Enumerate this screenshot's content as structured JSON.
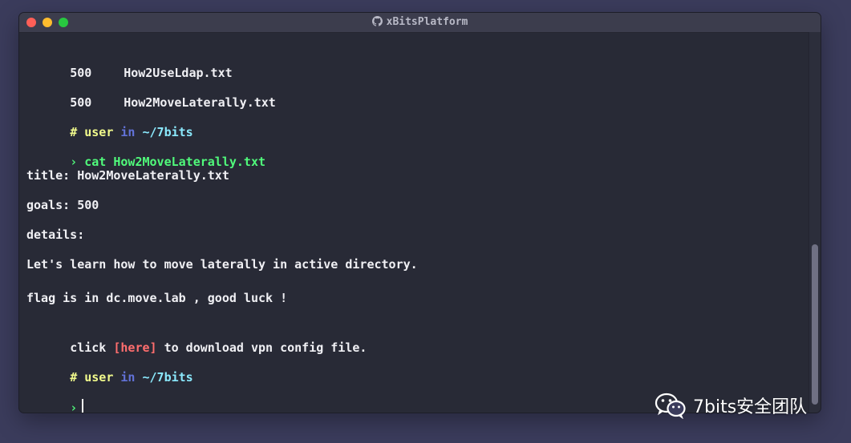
{
  "window": {
    "title": "xBitsPlatform",
    "title_icon": "github-icon",
    "controls": [
      "close",
      "minimize",
      "maximize"
    ]
  },
  "terminal": {
    "partial_top_line": "                        ",
    "rows": [
      {
        "num": "500",
        "name": "How2UseLdap.txt"
      },
      {
        "num": "500",
        "name": "How2MoveLaterally.txt"
      }
    ],
    "prompt1": {
      "hash": "#",
      "user": "user",
      "in": "in",
      "path": "~/7bits"
    },
    "command": {
      "arrow": "›",
      "text": "cat How2MoveLaterally.txt"
    },
    "output": {
      "title": "title: How2MoveLaterally.txt",
      "goals": "goals: 500",
      "details": "details:",
      "desc": "Let's learn how to move laterally in active directory.",
      "flag": "flag is in dc.move.lab , good luck !",
      "click_prefix": "click ",
      "click_link": "[here]",
      "click_suffix": " to download vpn config file."
    },
    "prompt2": {
      "hash": "#",
      "user": "user",
      "in": "in",
      "path": "~/7bits"
    },
    "input_arrow": "›"
  },
  "scroll": {
    "position_fraction": 0.55
  },
  "watermark": {
    "text": "7bits安全团队",
    "icon": "wechat-icon"
  },
  "colors": {
    "background": "#3b3c5c",
    "terminal_bg": "#282a36",
    "prompt_yellow": "#f1fa8c",
    "prompt_blue": "#6272d8",
    "path_cyan": "#8be9fd",
    "command_green": "#50fa7b",
    "link_red": "#ff6e6e"
  }
}
